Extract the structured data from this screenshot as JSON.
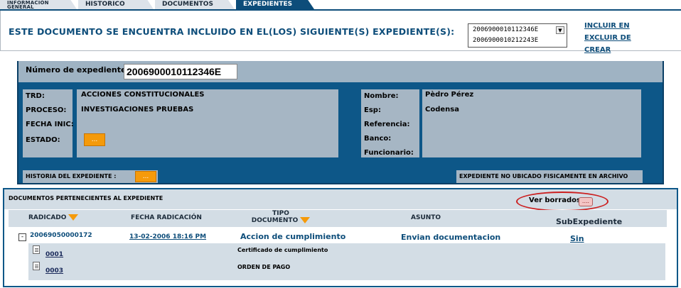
{
  "tabs": [
    {
      "label": "INFORMACIÓN GENERAL"
    },
    {
      "label": "HISTORICO"
    },
    {
      "label": "DOCUMENTOS"
    },
    {
      "label": "EXPEDIENTES"
    }
  ],
  "heading": "ESTE DOCUMENTO SE ENCUENTRA INCLUIDO EN EL(LOS) SIGUIENTE(S) EXPEDIENTE(S):",
  "expedientes_list": [
    "2006900010112346E",
    "2006900010212243E"
  ],
  "actions": {
    "incluir": "INCLUIR EN",
    "excluir": "EXCLUIR DE",
    "crear": "CREAR"
  },
  "expediente": {
    "numero_label": "Número de expediente",
    "numero": "2006900010112346E",
    "trd_label": "TRD:",
    "trd": "ACCIONES CONSTITUCIONALES",
    "proceso_label": "PROCESO:",
    "proceso": "INVESTIGACIONES PRUEBAS",
    "fecha_label": "FECHA INIC:",
    "estado_label": "ESTADO:",
    "estado_btn": "...",
    "nombre_label": "Nombre:",
    "nombre": "Pèdro Pérez",
    "esp_label": "Esp:",
    "esp": "Codensa",
    "referencia_label": "Referencia:",
    "banco_label": "Banco:",
    "funcionario_label": "Funcionario:",
    "historia_label": "HISTORIA DEL EXPEDIENTE :",
    "historia_btn": "...",
    "archivo_label": "EXPEDIENTE NO UBICADO FISICAMENTE EN ARCHIVO"
  },
  "docs": {
    "title": "DOCUMENTOS PERTENECIENTES AL EXPEDIENTE",
    "ver_borrados": "Ver borrados",
    "ver_borrados_btn": "....",
    "columns": {
      "radicado": "RADICADO",
      "fecha": "FECHA RADICACIÓN",
      "tipo_1": "TIPO",
      "tipo_2": "DOCUMENTO",
      "asunto": "ASUNTO",
      "subexp": "SubExpediente"
    },
    "row": {
      "toggle": "-",
      "radicado": "20069050000172",
      "fecha": "13-02-2006 18:16 PM",
      "tipo": "Accion de cumplimiento",
      "asunto": "Envian documentacion",
      "subexp": "Sin"
    },
    "anexos": [
      {
        "codigo": "0001",
        "descripcion": "Certificado de cumplimiento"
      },
      {
        "codigo": "0003",
        "descripcion": "ORDEN DE PAGO"
      }
    ]
  },
  "colors": {
    "primary": "#0d5788",
    "accent": "#f59a0a",
    "field_bg": "#a6b6c4",
    "highlight_circle": "#cc1f1f"
  }
}
